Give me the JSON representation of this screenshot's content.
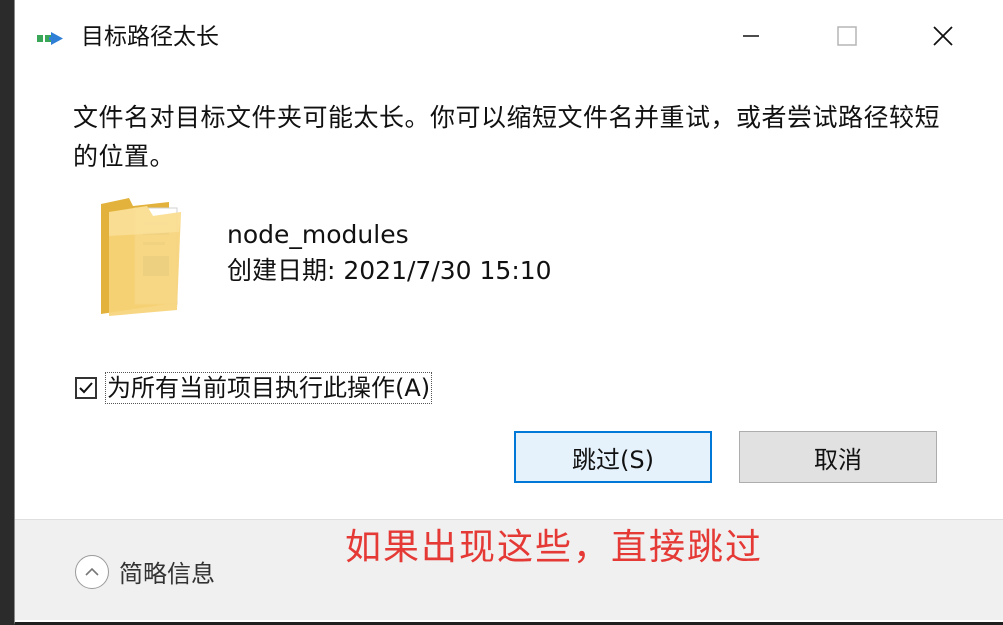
{
  "window": {
    "title": "目标路径太长"
  },
  "dialog": {
    "message": "文件名对目标文件夹可能太长。你可以缩短文件名并重试，或者尝试路径较短的位置。",
    "file": {
      "name": "node_modules",
      "created": "创建日期: 2021/7/30 15:10"
    },
    "apply_all": {
      "label": "为所有当前项目执行此操作(A)",
      "checked": true
    },
    "buttons": {
      "skip": "跳过(S)",
      "cancel": "取消"
    },
    "details_toggle": "简略信息"
  },
  "annotation": {
    "text": "如果出现这些，直接跳过",
    "color": "#e53935"
  },
  "colors": {
    "accent": "#0078d7",
    "footer_bg": "#f0f0f0"
  },
  "icons": {
    "app": "move-files-icon",
    "folder": "folder-icon",
    "minimize": "minimize-icon",
    "maximize": "maximize-icon",
    "close": "close-icon",
    "details": "chevron-up-icon"
  }
}
